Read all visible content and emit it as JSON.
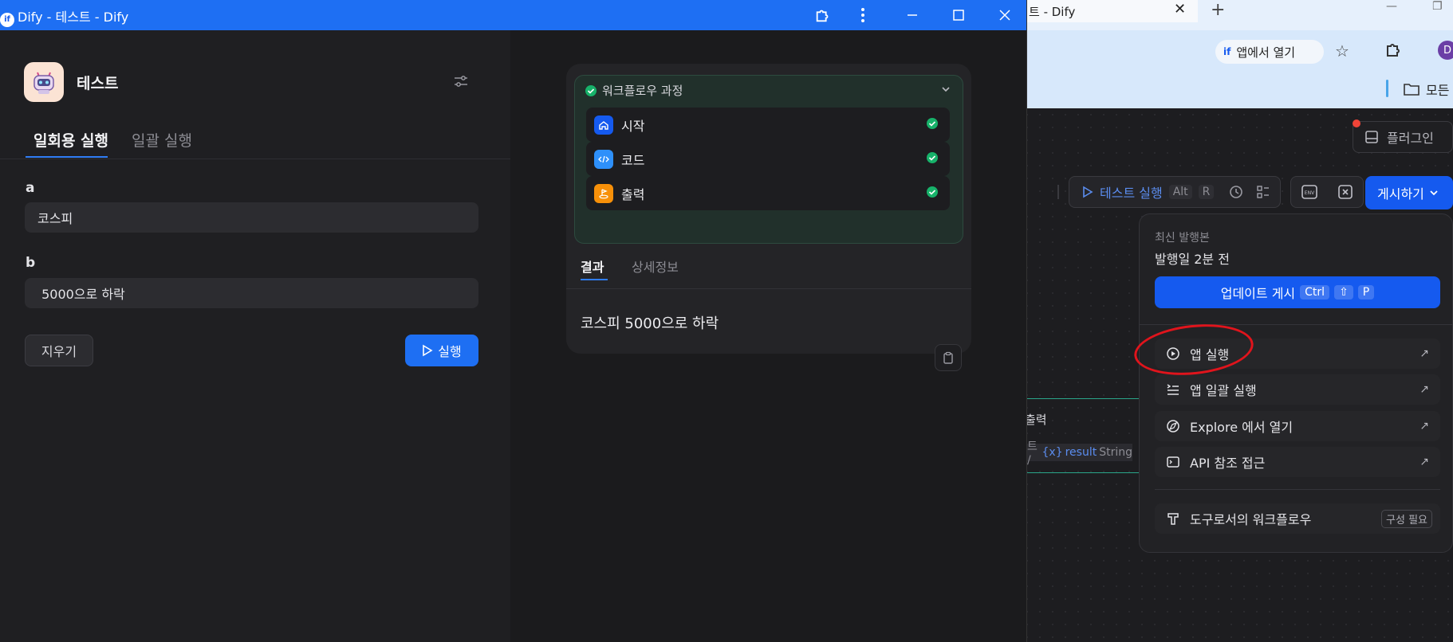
{
  "bg_browser": {
    "tab_title": "트 - Dify",
    "tab_close": "✕",
    "new_tab": "+",
    "open_in_app": "앱에서 열기",
    "avatar_letter": "D",
    "bookmark_folder": "모든"
  },
  "canvas": {
    "plugin_label": "플러그인",
    "test_run_label": "테스트 실행",
    "test_run_keys": [
      "Alt",
      "R"
    ],
    "publish_label": "게시하기",
    "output_node_title": "출력",
    "output_var_prefix": "트 /",
    "output_var_name": "result",
    "output_var_type": "String"
  },
  "publish_dropdown": {
    "latest_label": "최신 발행본",
    "published_when": "발행일 2분 전",
    "update_label": "업데이트 게시",
    "update_keys": [
      "Ctrl",
      "⇧",
      "P"
    ],
    "items": [
      {
        "label": "앱 실행",
        "icon": "play-circle-icon"
      },
      {
        "label": "앱 일괄 실행",
        "icon": "batch-list-icon"
      },
      {
        "label": "Explore 에서 열기",
        "icon": "compass-icon"
      },
      {
        "label": "API 참조 접근",
        "icon": "terminal-icon"
      }
    ],
    "tool_workflow_label": "도구로서의 워크플로우",
    "tool_workflow_badge": "구성 필요"
  },
  "window": {
    "title": "Dify - 테스트 - Dify",
    "app_name": "테스트",
    "tabs": {
      "single": "일회용 실행",
      "batch": "일괄 실행"
    },
    "fields": [
      {
        "label": "a",
        "value": "코스피"
      },
      {
        "label": "b",
        "value": " 5000으로 하락"
      }
    ],
    "clear_label": "지우기",
    "run_label": "실행"
  },
  "result": {
    "workflow_title": "워크플로우 과정",
    "nodes": [
      {
        "label": "시작",
        "color": "#155aef"
      },
      {
        "label": "코드",
        "color": "#2e90fa"
      },
      {
        "label": "출력",
        "color": "#f79009"
      }
    ],
    "tab_result": "결과",
    "tab_detail": "상세정보",
    "output_text": "코스피 5000으로 하락"
  }
}
